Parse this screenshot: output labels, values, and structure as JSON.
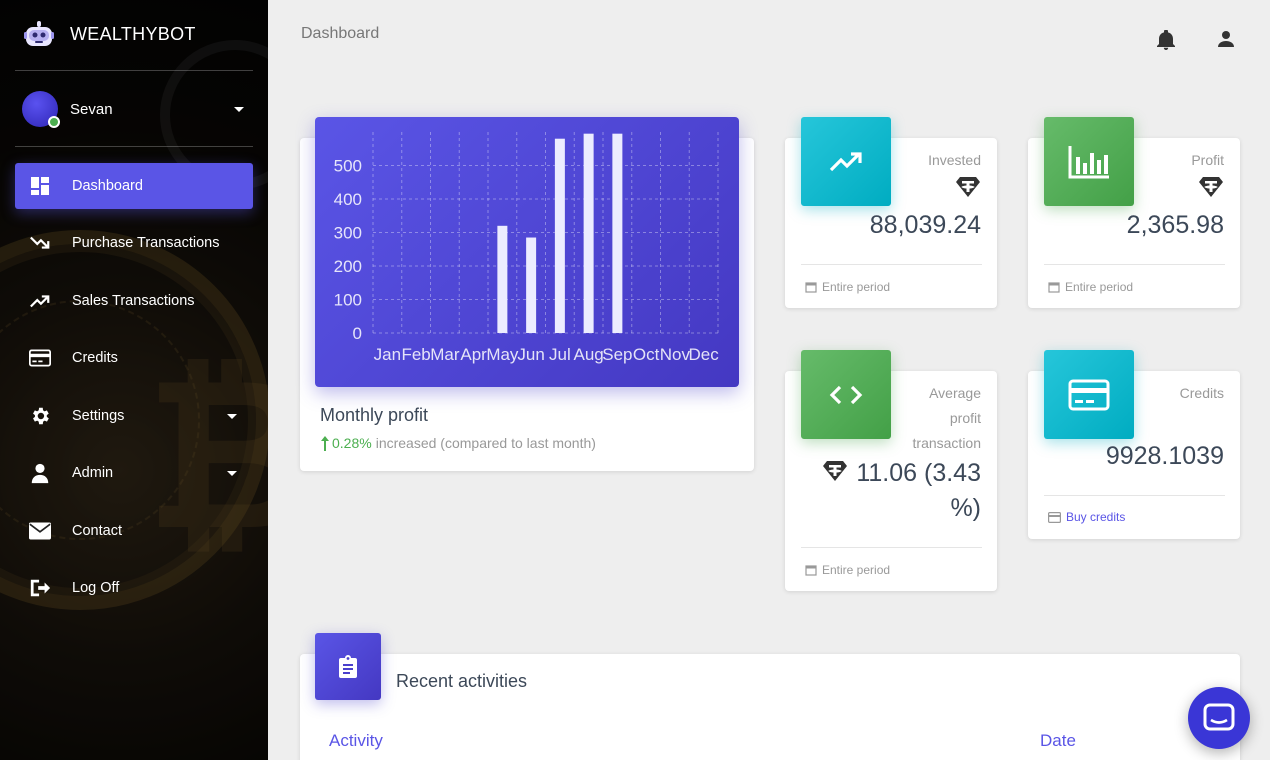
{
  "app": {
    "name": "WEALTHYBOT"
  },
  "user": {
    "name": "Sevan",
    "status": "online"
  },
  "nav": {
    "items": [
      {
        "label": "Dashboard",
        "icon": "dashboard-icon",
        "active": true
      },
      {
        "label": "Purchase Transactions",
        "icon": "trending-down-icon"
      },
      {
        "label": "Sales Transactions",
        "icon": "trending-up-icon"
      },
      {
        "label": "Credits",
        "icon": "credit-card-icon"
      },
      {
        "label": "Settings",
        "icon": "gear-icon",
        "expandable": true
      },
      {
        "label": "Admin",
        "icon": "person-icon",
        "expandable": true
      },
      {
        "label": "Contact",
        "icon": "mail-icon"
      },
      {
        "label": "Log Off",
        "icon": "logout-icon"
      }
    ]
  },
  "header": {
    "title": "Dashboard",
    "icons": [
      "bell-icon",
      "user-icon"
    ]
  },
  "monthly_profit": {
    "title": "Monthly profit",
    "change_pct": "0.28%",
    "change_text": "increased (compared to last month)"
  },
  "chart_data": {
    "type": "bar",
    "categories": [
      "Jan",
      "Feb",
      "Mar",
      "Apr",
      "May",
      "Jun",
      "Jul",
      "Aug",
      "Sep",
      "Oct",
      "Nov",
      "Dec"
    ],
    "values": [
      0,
      0,
      0,
      0,
      320,
      285,
      580,
      595,
      595,
      0,
      0,
      0
    ],
    "yticks": [
      0,
      100,
      200,
      300,
      400,
      500
    ],
    "ylim": [
      0,
      600
    ],
    "grid": true,
    "colors": {
      "bar": "#ececff",
      "grid": "rgba(255,255,255,0.35)",
      "background": "#5a55e6"
    }
  },
  "stats": {
    "invested": {
      "label": "Invested",
      "value": "88,039.24",
      "footer": "Entire period",
      "icon": "trending-up-icon"
    },
    "profit": {
      "label": "Profit",
      "value": "2,365.98",
      "footer": "Entire period",
      "icon": "bar-chart-icon"
    },
    "avg_profit": {
      "label_lines": [
        "Average",
        "profit",
        "transaction"
      ],
      "value_line1": "11.06 (3.43",
      "value_line2": "%)",
      "footer": "Entire period",
      "icon": "code-icon"
    },
    "credits": {
      "label": "Credits",
      "value": "9928.1039",
      "footer": "Buy credits",
      "icon": "credit-card-icon"
    }
  },
  "recent": {
    "title": "Recent activities",
    "columns": [
      "Activity",
      "Date"
    ]
  },
  "colors": {
    "accent": "#5a55e6",
    "cyan": "#00acc1",
    "green": "#43a047",
    "positive": "#4caf50"
  }
}
